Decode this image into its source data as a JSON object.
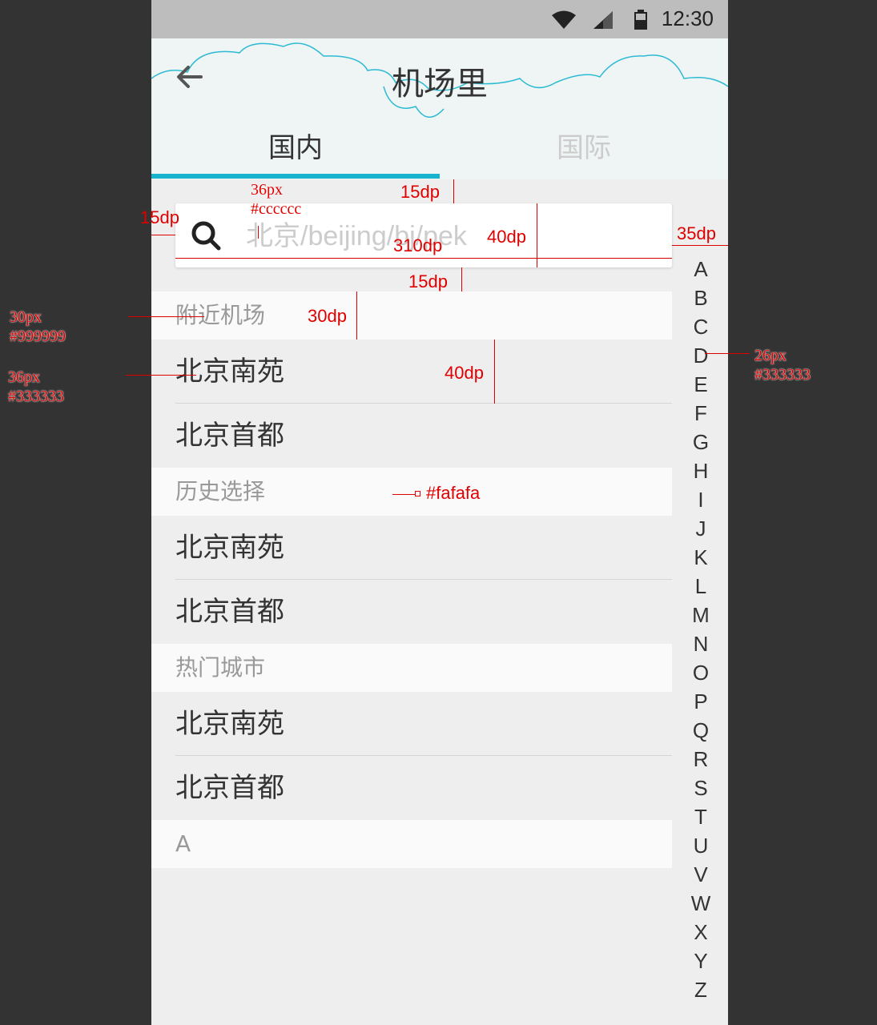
{
  "status_bar": {
    "time": "12:30"
  },
  "header": {
    "title": "机场里"
  },
  "tabs": [
    {
      "label": "国内",
      "active": true
    },
    {
      "label": "国际",
      "active": false
    }
  ],
  "search": {
    "placeholder": "北京/beijing/bj/pek",
    "value": ""
  },
  "sections": [
    {
      "title": "附近机场",
      "items": [
        "北京南苑",
        "北京首都"
      ]
    },
    {
      "title": "历史选择",
      "items": [
        "北京南苑",
        "北京首都"
      ]
    },
    {
      "title": "热门城市",
      "items": [
        "北京南苑",
        "北京首都"
      ]
    },
    {
      "title": "A",
      "items": []
    }
  ],
  "index_letters": [
    "A",
    "B",
    "C",
    "D",
    "E",
    "F",
    "G",
    "H",
    "I",
    "J",
    "K",
    "L",
    "M",
    "N",
    "O",
    "P",
    "Q",
    "R",
    "S",
    "T",
    "U",
    "V",
    "W",
    "X",
    "Y",
    "Z"
  ],
  "annotations": {
    "search_font": "36px",
    "search_color": "#cccccc",
    "top_gap": "15dp",
    "left_gap": "15dp",
    "search_height": "40dp",
    "search_width": "310dp",
    "index_width": "35dp",
    "bottom_gap": "15dp",
    "section_height": "30dp",
    "item_height": "40dp",
    "section_font": "30px",
    "section_color": "#999999",
    "item_font": "36px",
    "item_color": "#333333",
    "index_font": "26px",
    "index_color": "#333333",
    "section_bg": "#fafafa"
  },
  "colors": {
    "accent": "#17b3cf",
    "text_primary": "#333333",
    "text_secondary": "#999999",
    "placeholder": "#cccccc",
    "section_bg": "#fafafa"
  }
}
